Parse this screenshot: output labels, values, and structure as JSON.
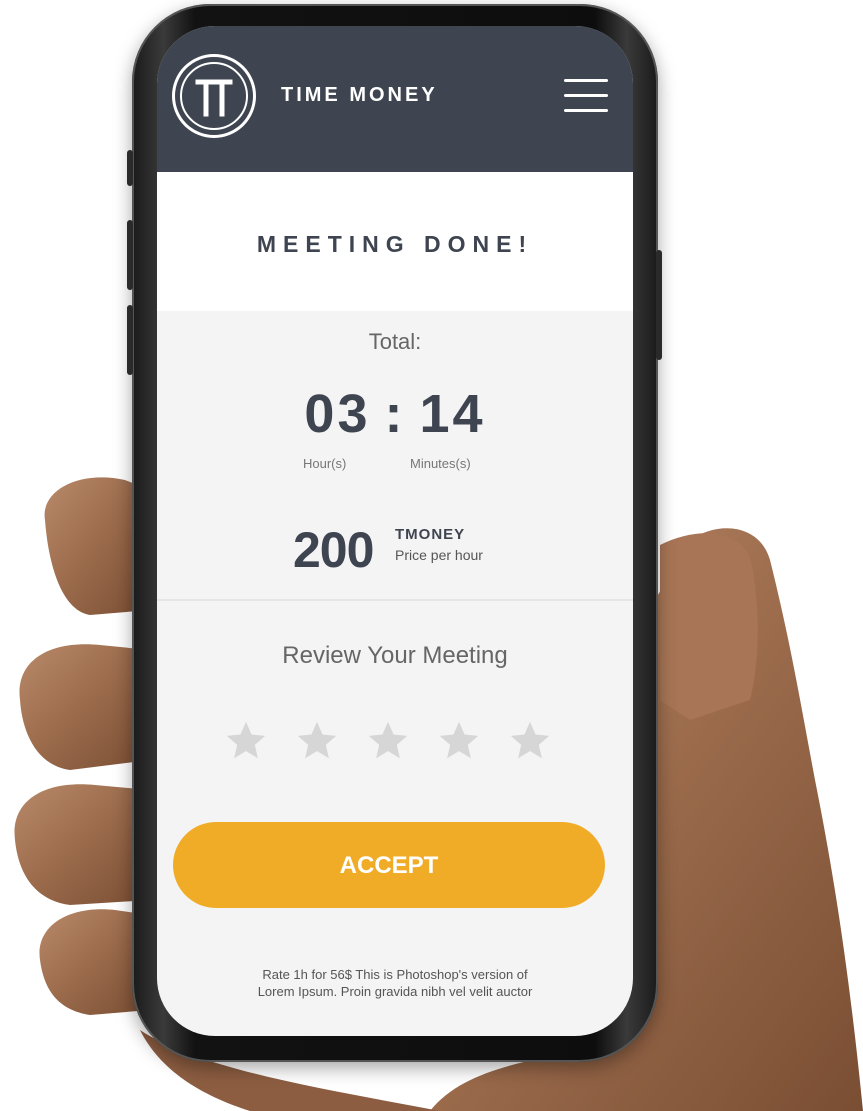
{
  "header": {
    "brand": "TIME MONEY",
    "logo_letter": "T"
  },
  "main": {
    "title": "MEETING DONE!",
    "total_label": "Total:",
    "hours": "03",
    "separator": ":",
    "minutes": "14",
    "hours_unit": "Hour(s)",
    "minutes_unit": "Minutes(s)",
    "price_value": "200",
    "price_currency": "TMONEY",
    "price_caption": "Price per hour",
    "review_label": "Review Your Meeting",
    "rating": 0,
    "rating_max": 5,
    "accept_label": "ACCEPT",
    "footer_line1": "Rate 1h for 56$ This is Photoshop's version  of",
    "footer_line2": "Lorem Ipsum. Proin gravida nibh vel velit auctor"
  },
  "colors": {
    "header_bg": "#3e4450",
    "accent": "#f0ac27",
    "star_empty": "#d6d6d6",
    "text_dark": "#3e4450"
  },
  "icons": {
    "logo": "t-logo-icon",
    "menu": "hamburger-menu-icon",
    "star": "star-icon"
  }
}
